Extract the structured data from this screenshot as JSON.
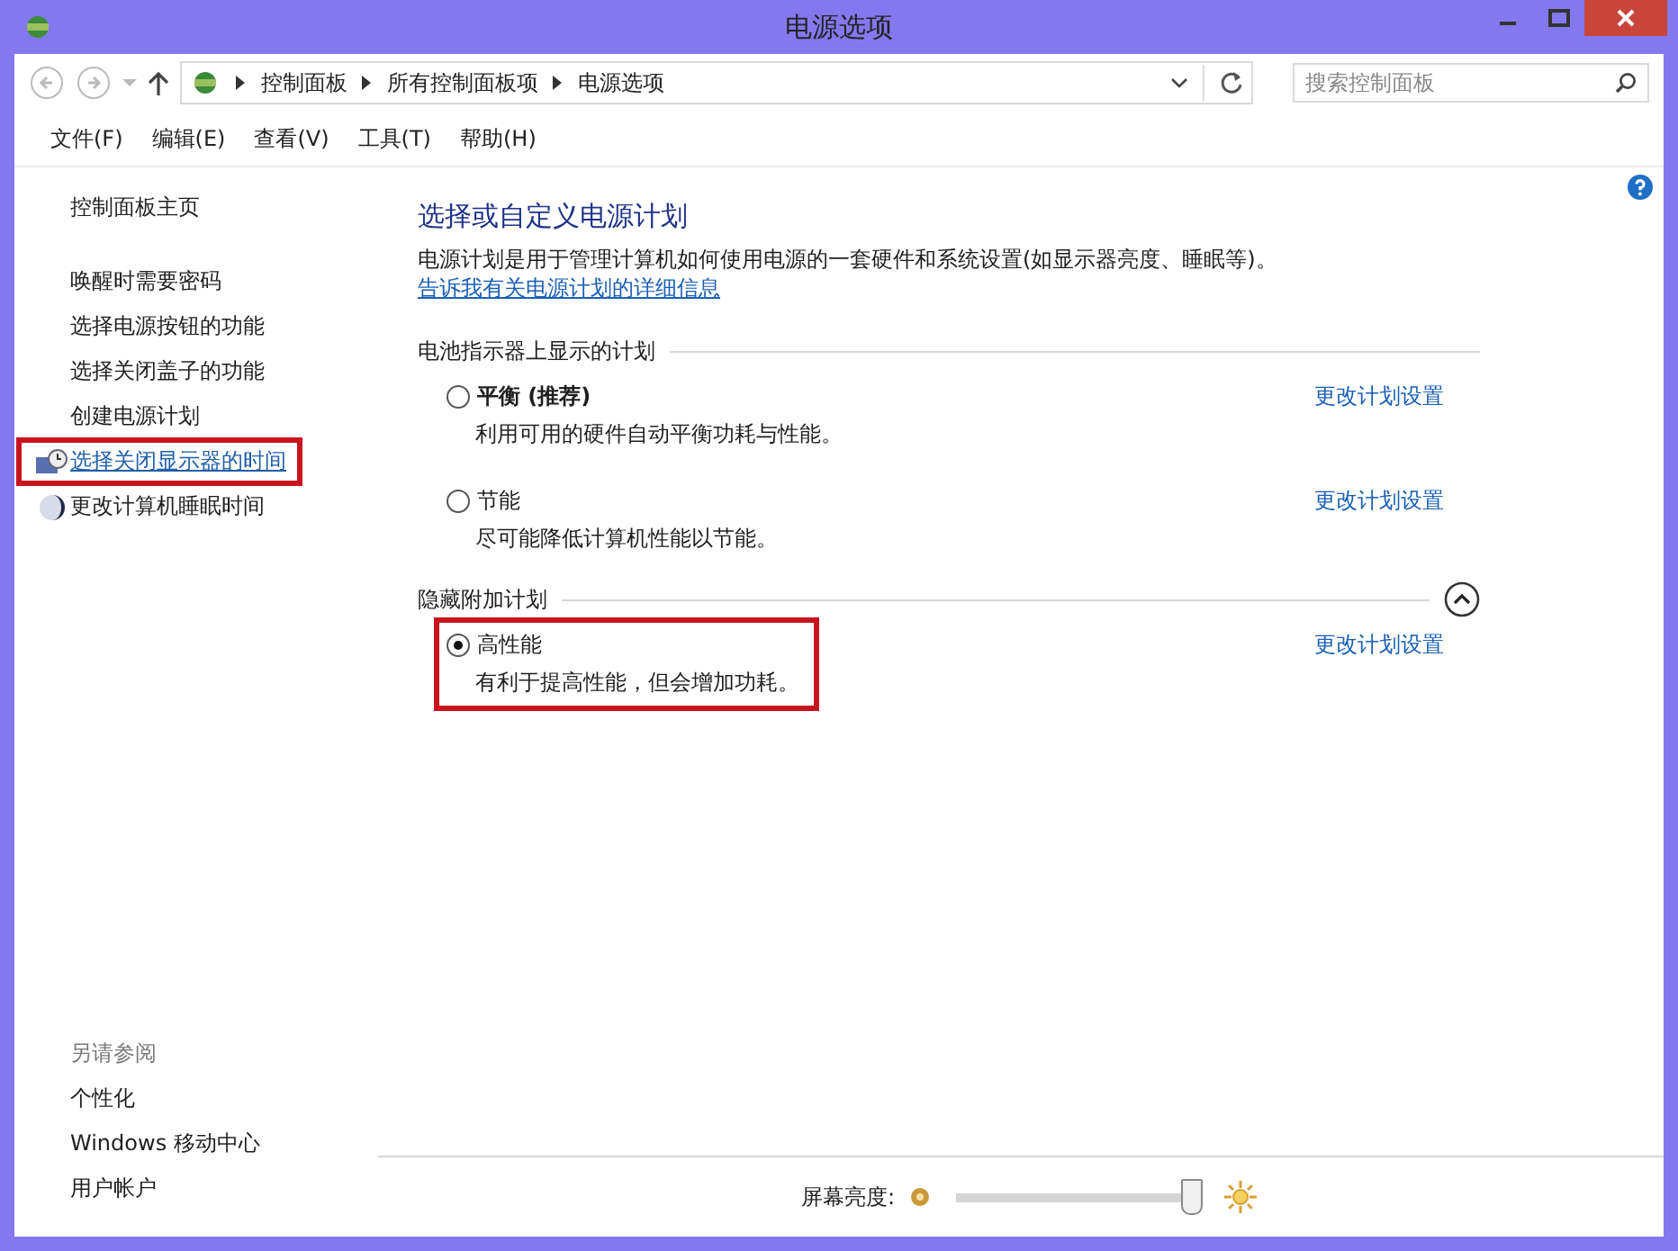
{
  "window": {
    "title": "电源选项"
  },
  "address_bar": {
    "path": [
      "控制面板",
      "所有控制面板项",
      "电源选项"
    ],
    "search_placeholder": "搜索控制面板"
  },
  "menu": [
    "文件(F)",
    "编辑(E)",
    "查看(V)",
    "工具(T)",
    "帮助(H)"
  ],
  "sidebar": {
    "home": "控制面板主页",
    "items": [
      {
        "label": "唤醒时需要密码",
        "kind": "plain",
        "selected": false,
        "highlighted": false
      },
      {
        "label": "选择电源按钮的功能",
        "kind": "plain",
        "selected": false,
        "highlighted": false
      },
      {
        "label": "选择关闭盖子的功能",
        "kind": "plain",
        "selected": false,
        "highlighted": false
      },
      {
        "label": "创建电源计划",
        "kind": "plain",
        "selected": false,
        "highlighted": false
      },
      {
        "label": "选择关闭显示器的时间",
        "kind": "display",
        "selected": true,
        "highlighted": true
      },
      {
        "label": "更改计算机睡眠时间",
        "kind": "sleep",
        "selected": false,
        "highlighted": false
      }
    ],
    "see_also": {
      "title": "另请参阅",
      "items": [
        "个性化",
        "Windows 移动中心",
        "用户帐户"
      ]
    }
  },
  "main": {
    "heading": "选择或自定义电源计划",
    "description": "电源计划是用于管理计算机如何使用电源的一套硬件和系统设置(如显示器亮度、睡眠等)。",
    "description_link": "告诉我有关电源计划的详细信息",
    "groups": [
      {
        "title": "电池指示器上显示的计划",
        "collapsible": false,
        "plans": [
          {
            "name": "平衡 (推荐)",
            "bold": true,
            "description": "利用可用的硬件自动平衡功耗与性能。",
            "selected": false,
            "highlighted": false,
            "action": "更改计划设置"
          },
          {
            "name": "节能",
            "bold": false,
            "description": "尽可能降低计算机性能以节能。",
            "selected": false,
            "highlighted": false,
            "action": "更改计划设置"
          }
        ]
      },
      {
        "title": "隐藏附加计划",
        "collapsible": true,
        "plans": [
          {
            "name": "高性能",
            "bold": false,
            "description": "有利于提高性能，但会增加功耗。",
            "selected": true,
            "highlighted": true,
            "action": "更改计划设置"
          }
        ]
      }
    ]
  },
  "brightness": {
    "label": "屏幕亮度:",
    "level": 0.96
  }
}
